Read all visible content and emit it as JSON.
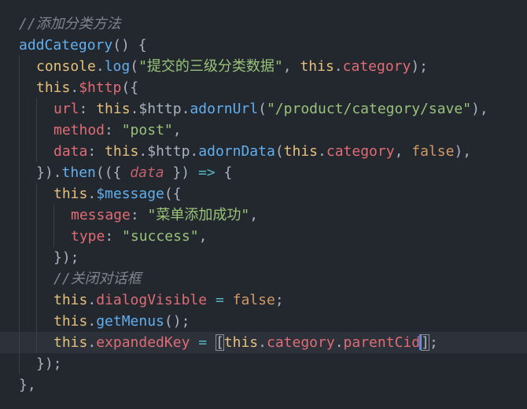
{
  "editor": {
    "lines": [
      {
        "indent": 0,
        "tokens": [
          {
            "t": "//添加分类方法",
            "c": "cm"
          }
        ]
      },
      {
        "indent": 0,
        "tokens": [
          {
            "t": "addCategory",
            "c": "fn"
          },
          {
            "t": "() {",
            "c": "pu"
          }
        ]
      },
      {
        "indent": 1,
        "tokens": [
          {
            "t": "console",
            "c": "kw"
          },
          {
            "t": ".",
            "c": "pu"
          },
          {
            "t": "log",
            "c": "fn"
          },
          {
            "t": "(",
            "c": "pu"
          },
          {
            "t": "\"提交的三级分类数据\"",
            "c": "st"
          },
          {
            "t": ", ",
            "c": "pu"
          },
          {
            "t": "this",
            "c": "kw"
          },
          {
            "t": ".",
            "c": "pu"
          },
          {
            "t": "category",
            "c": "pr"
          },
          {
            "t": ");",
            "c": "pu"
          }
        ]
      },
      {
        "indent": 1,
        "tokens": [
          {
            "t": "this",
            "c": "kw"
          },
          {
            "t": ".",
            "c": "pu"
          },
          {
            "t": "$http",
            "c": "pr"
          },
          {
            "t": "({",
            "c": "pu"
          }
        ]
      },
      {
        "indent": 2,
        "tokens": [
          {
            "t": "url",
            "c": "pr"
          },
          {
            "t": ": ",
            "c": "pu"
          },
          {
            "t": "this",
            "c": "kw"
          },
          {
            "t": ".$http.",
            "c": "pu"
          },
          {
            "t": "adornUrl",
            "c": "fn"
          },
          {
            "t": "(",
            "c": "pu"
          },
          {
            "t": "\"/product/category/save\"",
            "c": "st"
          },
          {
            "t": "),",
            "c": "pu"
          }
        ]
      },
      {
        "indent": 2,
        "tokens": [
          {
            "t": "method",
            "c": "pr"
          },
          {
            "t": ": ",
            "c": "pu"
          },
          {
            "t": "\"post\"",
            "c": "st"
          },
          {
            "t": ",",
            "c": "pu"
          }
        ]
      },
      {
        "indent": 2,
        "tokens": [
          {
            "t": "data",
            "c": "pr"
          },
          {
            "t": ": ",
            "c": "pu"
          },
          {
            "t": "this",
            "c": "kw"
          },
          {
            "t": ".$http.",
            "c": "pu"
          },
          {
            "t": "adornData",
            "c": "fn"
          },
          {
            "t": "(",
            "c": "pu"
          },
          {
            "t": "this",
            "c": "kw"
          },
          {
            "t": ".",
            "c": "pu"
          },
          {
            "t": "category",
            "c": "pr"
          },
          {
            "t": ", ",
            "c": "pu"
          },
          {
            "t": "false",
            "c": "bool"
          },
          {
            "t": "),",
            "c": "pu"
          }
        ]
      },
      {
        "indent": 1,
        "tokens": [
          {
            "t": "}).",
            "c": "pu"
          },
          {
            "t": "then",
            "c": "fn"
          },
          {
            "t": "(({ ",
            "c": "pu"
          },
          {
            "t": "data",
            "c": "pa"
          },
          {
            "t": " }) ",
            "c": "pu"
          },
          {
            "t": "=>",
            "c": "op"
          },
          {
            "t": " {",
            "c": "pu"
          }
        ]
      },
      {
        "indent": 2,
        "tokens": [
          {
            "t": "this",
            "c": "kw"
          },
          {
            "t": ".",
            "c": "pu"
          },
          {
            "t": "$message",
            "c": "fn"
          },
          {
            "t": "({",
            "c": "pu"
          }
        ]
      },
      {
        "indent": 3,
        "tokens": [
          {
            "t": "message",
            "c": "pr"
          },
          {
            "t": ": ",
            "c": "pu"
          },
          {
            "t": "\"菜单添加成功\"",
            "c": "st"
          },
          {
            "t": ",",
            "c": "pu"
          }
        ]
      },
      {
        "indent": 3,
        "tokens": [
          {
            "t": "type",
            "c": "pr"
          },
          {
            "t": ": ",
            "c": "pu"
          },
          {
            "t": "\"success\"",
            "c": "st"
          },
          {
            "t": ",",
            "c": "pu"
          }
        ]
      },
      {
        "indent": 2,
        "tokens": [
          {
            "t": "});",
            "c": "pu"
          }
        ]
      },
      {
        "indent": 2,
        "tokens": [
          {
            "t": "//关闭对话框",
            "c": "cm"
          }
        ]
      },
      {
        "indent": 2,
        "tokens": [
          {
            "t": "this",
            "c": "kw"
          },
          {
            "t": ".",
            "c": "pu"
          },
          {
            "t": "dialogVisible",
            "c": "pr"
          },
          {
            "t": " ",
            "c": "pu"
          },
          {
            "t": "=",
            "c": "op"
          },
          {
            "t": " ",
            "c": "pu"
          },
          {
            "t": "false",
            "c": "bool"
          },
          {
            "t": ";",
            "c": "pu"
          }
        ]
      },
      {
        "indent": 2,
        "tokens": [
          {
            "t": "this",
            "c": "kw"
          },
          {
            "t": ".",
            "c": "pu"
          },
          {
            "t": "getMenus",
            "c": "fn"
          },
          {
            "t": "();",
            "c": "pu"
          }
        ]
      },
      {
        "indent": 2,
        "current": true,
        "tokens": [
          {
            "t": "this",
            "c": "kw"
          },
          {
            "t": ".",
            "c": "pu"
          },
          {
            "t": "expandedKey",
            "c": "pr"
          },
          {
            "t": " ",
            "c": "pu"
          },
          {
            "t": "=",
            "c": "op"
          },
          {
            "t": " ",
            "c": "pu"
          },
          {
            "t": "[",
            "c": "pu",
            "match": true
          },
          {
            "t": "this",
            "c": "kw"
          },
          {
            "t": ".",
            "c": "pu"
          },
          {
            "t": "category",
            "c": "pr"
          },
          {
            "t": ".",
            "c": "pu"
          },
          {
            "t": "parentCid",
            "c": "pr",
            "cursor_after": true
          },
          {
            "t": "]",
            "c": "pu",
            "match": true
          },
          {
            "t": ";",
            "c": "pu"
          }
        ]
      },
      {
        "indent": 1,
        "tokens": [
          {
            "t": "});",
            "c": "pu"
          }
        ]
      },
      {
        "indent": 0,
        "tokens": [
          {
            "t": "},",
            "c": "pu"
          }
        ]
      }
    ]
  }
}
